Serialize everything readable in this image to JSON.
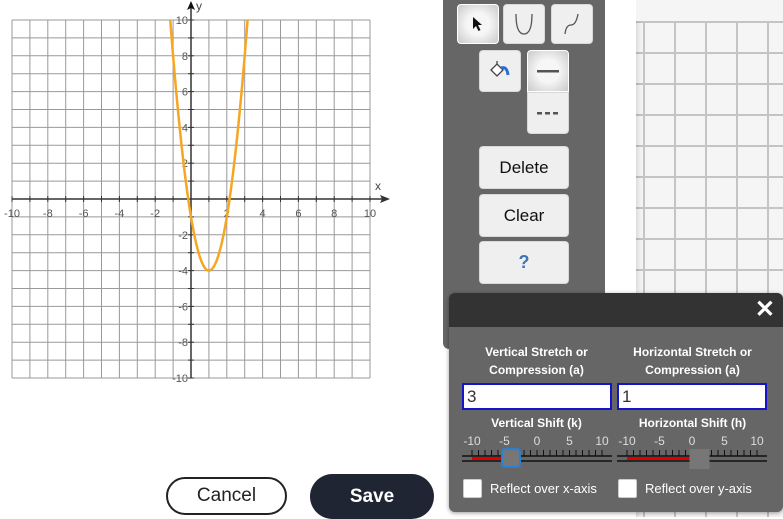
{
  "graph": {
    "x_axis_label": "x",
    "y_axis_label": "y",
    "x_range": [
      -10,
      10
    ],
    "y_range": [
      -10,
      10
    ],
    "x_tick_labels": [
      "-10",
      "-8",
      "-6",
      "-4",
      "-2",
      "2",
      "4",
      "6",
      "8",
      "10"
    ],
    "y_tick_labels": [
      "10",
      "8",
      "6",
      "4",
      "2",
      "-2",
      "-4",
      "-6",
      "-8",
      "-10"
    ],
    "curve": {
      "type": "parabola",
      "a": 3,
      "h": 1,
      "k": -4,
      "color": "#f5a623"
    }
  },
  "toolbar": {
    "tools": [
      {
        "name": "select-tool",
        "icon": "arrow-cursor-icon",
        "active": true
      },
      {
        "name": "parabola-tool",
        "icon": "parabola-icon",
        "active": false
      },
      {
        "name": "curve-tool",
        "icon": "s-curve-icon",
        "active": false
      },
      {
        "name": "fill-tool",
        "icon": "paint-bucket-icon",
        "active": false
      },
      {
        "name": "solid-line-tool",
        "icon": "solid-line-icon",
        "active": true
      },
      {
        "name": "dashed-line-tool",
        "icon": "dashed-line-icon",
        "active": false
      }
    ],
    "delete_label": "Delete",
    "clear_label": "Clear",
    "help_label": "?"
  },
  "dialog": {
    "close_label": "✕",
    "vertical_stretch_label_1": "Vertical Stretch or",
    "vertical_stretch_label_2": "Compression (a)",
    "vertical_stretch_value": "3",
    "horizontal_stretch_label_1": "Horizontal Stretch or",
    "horizontal_stretch_label_2": "Compression (a)",
    "horizontal_stretch_value": "1",
    "vertical_shift_label": "Vertical Shift (k)",
    "horizontal_shift_label": "Horizontal Shift (h)",
    "slider_tick_labels": [
      "-10",
      "-5",
      "0",
      "5",
      "10"
    ],
    "vertical_shift_value": -4,
    "horizontal_shift_value": 1,
    "slider_range": [
      -10,
      10
    ],
    "reflect_x_label": "Reflect over x-axis",
    "reflect_x_checked": false,
    "reflect_y_label": "Reflect over y-axis",
    "reflect_y_checked": false
  },
  "actions": {
    "cancel_label": "Cancel",
    "save_label": "Save"
  }
}
